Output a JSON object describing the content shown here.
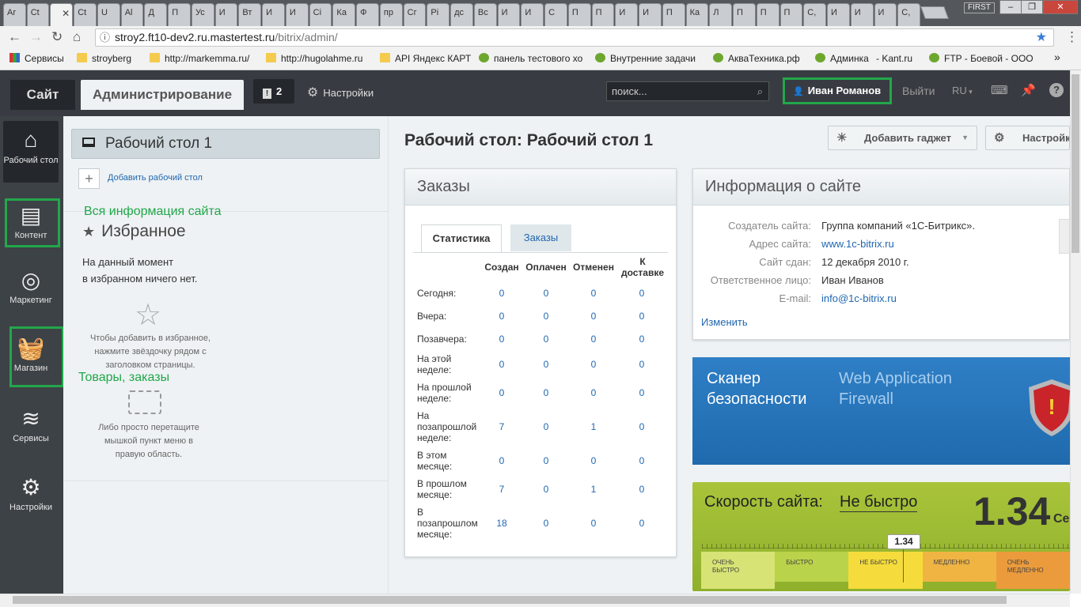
{
  "browser": {
    "tabs": [
      "Ar",
      "Ct",
      "",
      "Ct",
      "U",
      "Al",
      "Д",
      "П",
      "Ус",
      "И",
      "Вт",
      "И",
      "И",
      "Сі",
      "Ка",
      "Ф",
      "пр",
      "Сг",
      "Рі",
      "дс",
      "Вс",
      "И",
      "И",
      "С",
      "П",
      "П",
      "И",
      "И",
      "П",
      "Ка",
      "Л",
      "П",
      "П",
      "П",
      "С,",
      "И",
      "И",
      "И",
      "С,"
    ],
    "first_label": "FIRST",
    "url_domain": "stroy2.ft10-dev2.ru.mastertest.ru",
    "url_path": "/bitrix/admin/",
    "bookmarks": [
      "Сервисы",
      "stroyberg",
      "http://markemma.ru/",
      "http://hugolahme.ru",
      "API Яндекс КАРТ",
      "панель тестового хо",
      "Внутренние задачи",
      "АкваТехника.рф",
      "Админка",
      "- Kant.ru",
      "FTP - Боевой - ООО"
    ],
    "more": "»"
  },
  "header": {
    "site_tab": "Сайт",
    "admin_tab": "Администрирование",
    "notif_count": "2",
    "settings": "Настройки",
    "search_placeholder": "поиск...",
    "user": "Иван Романов",
    "logout": "Выйти",
    "lang": "RU"
  },
  "leftmenu": {
    "items": [
      {
        "label": "Рабочий стол",
        "icon": "home-icon"
      },
      {
        "label": "Контент",
        "icon": "document-icon"
      },
      {
        "label": "Маркетинг",
        "icon": "target-icon"
      },
      {
        "label": "Магазин",
        "icon": "basket-icon"
      },
      {
        "label": "Сервисы",
        "icon": "layers-icon"
      },
      {
        "label": "Настройки",
        "icon": "gear-icon"
      }
    ]
  },
  "panel": {
    "desktop_title": "Рабочий стол 1",
    "add_desktop": "Добавить рабочий стол",
    "annotation_info": "Вся информация сайта",
    "annotation_goods": "Товары, заказы",
    "favorites_title": "Избранное",
    "favorites_empty_1": "На данный момент",
    "favorites_empty_2": "в избранном ничего нет.",
    "hint_add_1": "Чтобы добавить в избранное,",
    "hint_add_2": "нажмите звёздочку рядом с",
    "hint_add_3": "заголовком страницы.",
    "hint_drag_1": "Либо просто перетащите",
    "hint_drag_2": "мышкой пункт меню в",
    "hint_drag_3": "правую область."
  },
  "main": {
    "title": "Рабочий стол: Рабочий стол 1",
    "add_gadget": "Добавить гаджет",
    "settings_btn": "Настройки"
  },
  "orders": {
    "title": "Заказы",
    "tab_stats": "Статистика",
    "tab_orders": "Заказы",
    "columns": [
      "Создан",
      "Оплачен",
      "Отменен",
      "К доставке"
    ],
    "rows": [
      {
        "label": "Сегодня:",
        "values": [
          "0",
          "0",
          "0",
          "0"
        ]
      },
      {
        "label": "Вчера:",
        "values": [
          "0",
          "0",
          "0",
          "0"
        ]
      },
      {
        "label": "Позавчера:",
        "values": [
          "0",
          "0",
          "0",
          "0"
        ]
      },
      {
        "label": "На этой неделе:",
        "values": [
          "0",
          "0",
          "0",
          "0"
        ]
      },
      {
        "label": "На прошлой неделе:",
        "values": [
          "0",
          "0",
          "0",
          "0"
        ]
      },
      {
        "label": "На позапрошлой неделе:",
        "values": [
          "7",
          "0",
          "1",
          "0"
        ]
      },
      {
        "label": "В этом месяце:",
        "values": [
          "0",
          "0",
          "0",
          "0"
        ]
      },
      {
        "label": "В прошлом месяце:",
        "values": [
          "7",
          "0",
          "1",
          "0"
        ]
      },
      {
        "label": "В позапрошлом месяце:",
        "values": [
          "18",
          "0",
          "0",
          "0"
        ]
      }
    ]
  },
  "info": {
    "title": "Информация о сайте",
    "rows": [
      {
        "label": "Создатель сайта:",
        "value": "Группа компаний «1С-Битрикс»."
      },
      {
        "label": "Адрес сайта:",
        "value": "www.1c-bitrix.ru"
      },
      {
        "label": "Сайт сдан:",
        "value": "12 декабря 2010 г."
      },
      {
        "label": "Ответственное лицо:",
        "value": "Иван Иванов"
      },
      {
        "label": "E-mail:",
        "value": "info@1c-bitrix.ru"
      }
    ],
    "edit": "Изменить"
  },
  "scanner": {
    "title_1": "Сканер",
    "title_2": "безопасности",
    "waf_1": "Web Application",
    "waf_2": "Firewall"
  },
  "speed": {
    "label": "Скорость сайта:",
    "verdict": "Не быстро",
    "value": "1.34",
    "unit": "Се",
    "level": 1.34,
    "segments": [
      {
        "text": "ОЧЕНЬ БЫСТРО",
        "color": "#d7e374"
      },
      {
        "text": "БЫСТРО",
        "color": "#b9d34b"
      },
      {
        "text": "НЕ БЫСТРО",
        "color": "#f5dc3c"
      },
      {
        "text": "МЕДЛЕННО",
        "color": "#f0b443"
      },
      {
        "text": "ОЧЕНЬ МЕДЛЕННО",
        "color": "#ec9b3c"
      }
    ]
  },
  "colors": {
    "accent_green": "#22a74a",
    "link": "#2067b0",
    "header_dark": "#383c42"
  }
}
